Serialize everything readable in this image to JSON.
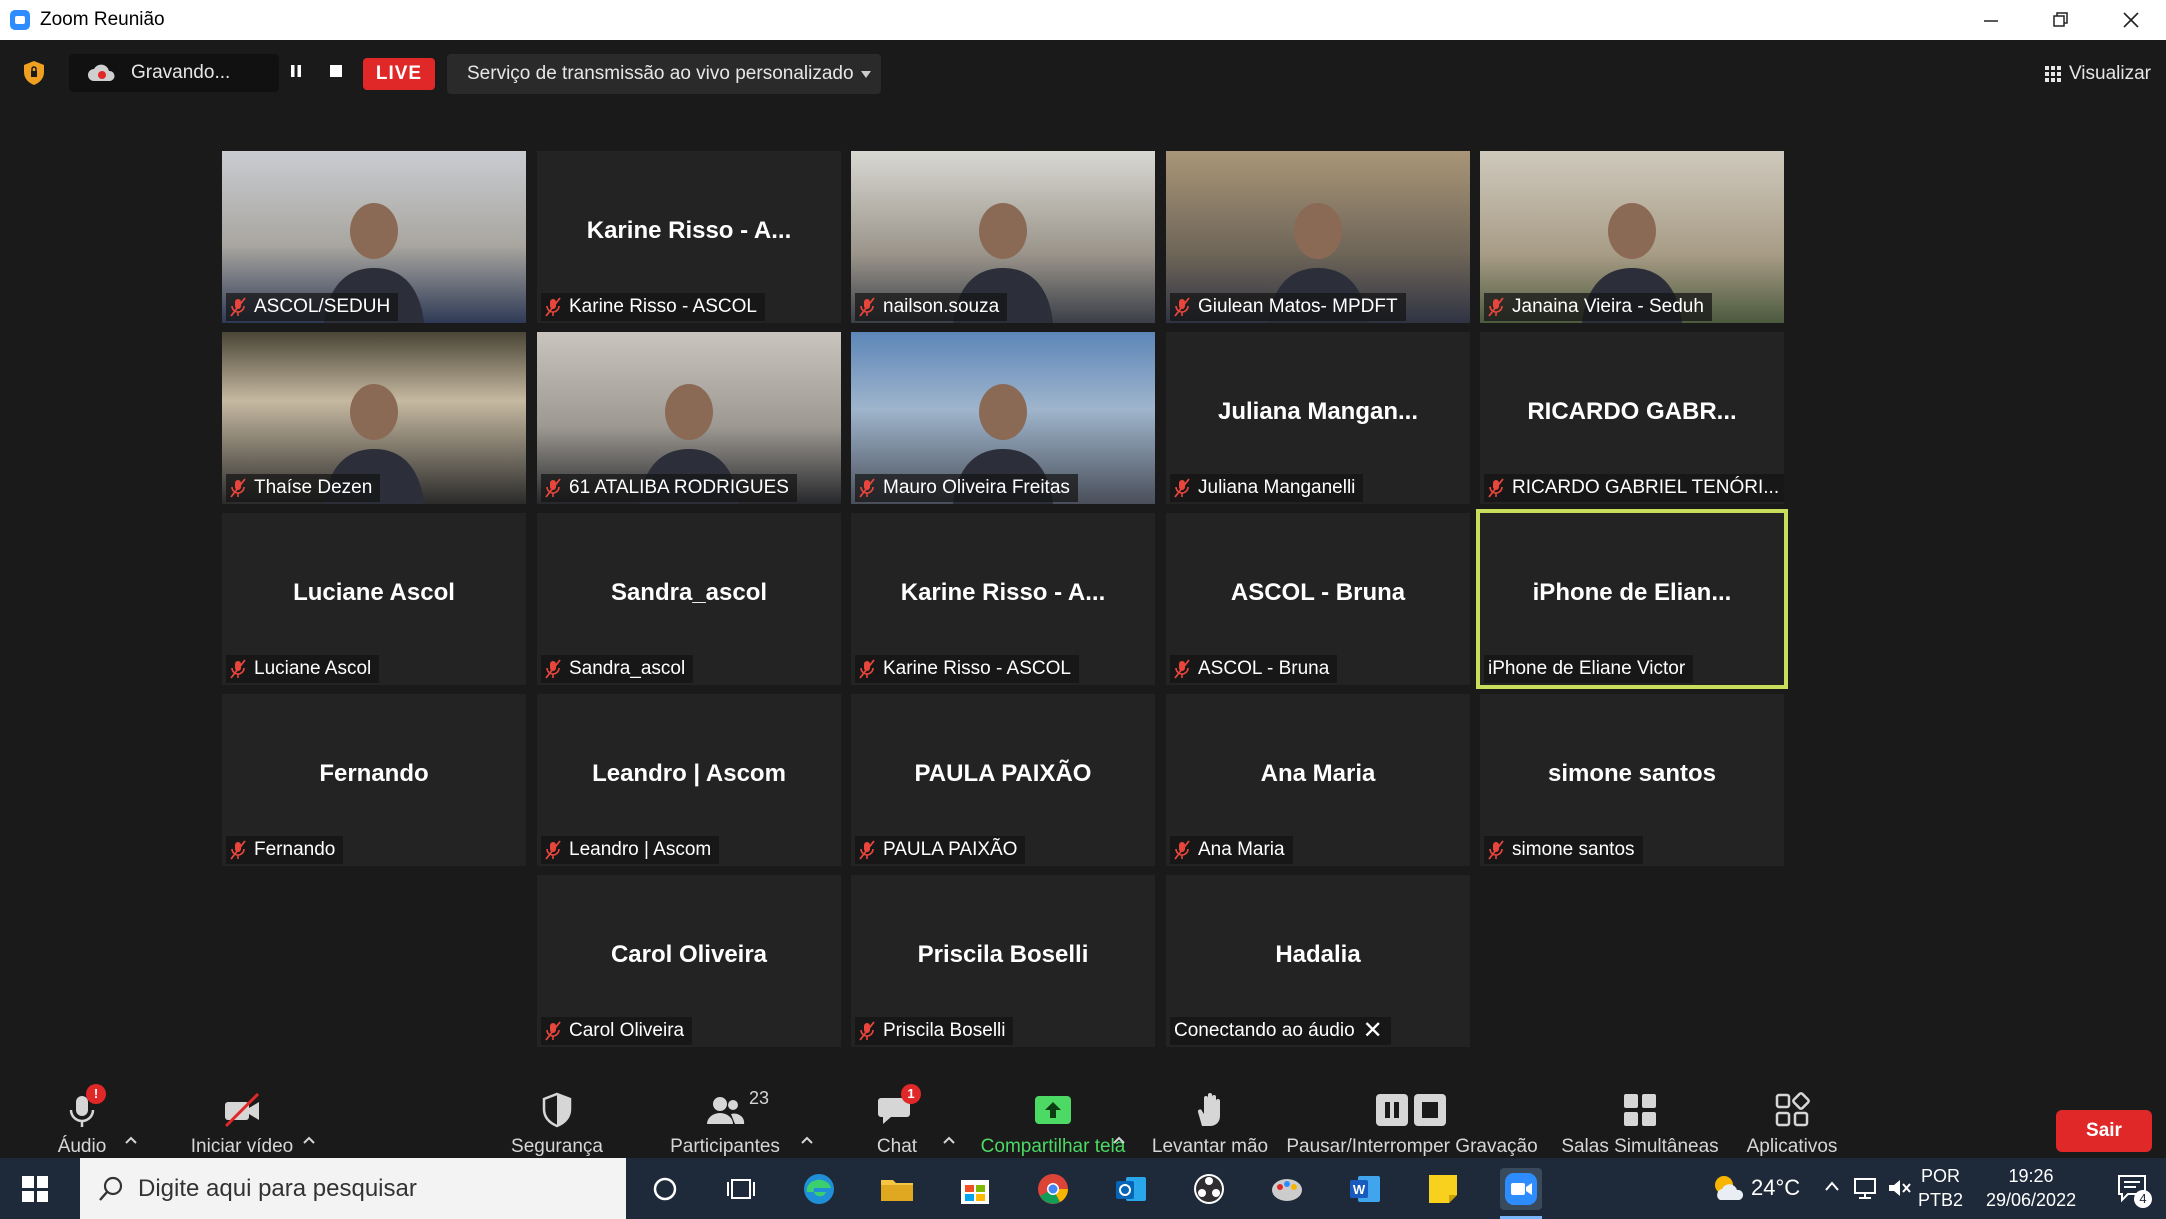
{
  "window": {
    "title": "Zoom Reunião"
  },
  "topbar": {
    "recording_label": "Gravando...",
    "live_label": "LIVE",
    "stream_select": "Serviço de transmissão ao vivo personalizado",
    "view_label": "Visualizar"
  },
  "tiles": [
    {
      "display": "",
      "tag": "ASCOL/SEDUH",
      "video": true
    },
    {
      "display": "Karine Risso - A...",
      "tag": "Karine Risso - ASCOL",
      "video": false
    },
    {
      "display": "",
      "tag": "nailson.souza",
      "video": true
    },
    {
      "display": "",
      "tag": "Giulean Matos- MPDFT",
      "video": true
    },
    {
      "display": "",
      "tag": "Janaina Vieira - Seduh",
      "video": true
    },
    {
      "display": "",
      "tag": "Thaíse Dezen",
      "video": true
    },
    {
      "display": "",
      "tag": "61 ATALIBA RODRIGUES",
      "video": true
    },
    {
      "display": "",
      "tag": "Mauro Oliveira Freitas",
      "video": true
    },
    {
      "display": "Juliana Mangan...",
      "tag": "Juliana Manganelli",
      "video": false
    },
    {
      "display": "RICARDO GABR...",
      "tag": "RICARDO GABRIEL TENÓRI...",
      "video": false
    },
    {
      "display": "Luciane Ascol",
      "tag": "Luciane Ascol",
      "video": false
    },
    {
      "display": "Sandra_ascol",
      "tag": "Sandra_ascol",
      "video": false
    },
    {
      "display": "Karine Risso - A...",
      "tag": "Karine Risso - ASCOL",
      "video": false
    },
    {
      "display": "ASCOL - Bruna",
      "tag": "ASCOL - Bruna",
      "video": false
    },
    {
      "display": "iPhone de Elian...",
      "tag": "iPhone de Eliane Victor",
      "video": false,
      "active": true
    },
    {
      "display": "Fernando",
      "tag": "Fernando",
      "video": false
    },
    {
      "display": "Leandro | Ascom",
      "tag": "Leandro | Ascom",
      "video": false
    },
    {
      "display": "PAULA PAIXÃO",
      "tag": "PAULA PAIXÃO",
      "video": false
    },
    {
      "display": "Ana Maria",
      "tag": "Ana Maria",
      "video": false
    },
    {
      "display": "simone santos",
      "tag": "simone santos",
      "video": false
    },
    {
      "display": "Carol Oliveira",
      "tag": "Carol Oliveira",
      "video": false
    },
    {
      "display": "Priscila Boselli",
      "tag": "Priscila Boselli",
      "video": false
    },
    {
      "display": "Hadalia",
      "tag": "Conectando ao áudio",
      "video": false,
      "connecting": true
    }
  ],
  "toolbar": {
    "audio": "Áudio",
    "audio_badge": "!",
    "video": "Iniciar vídeo",
    "security": "Segurança",
    "participants": "Participantes",
    "participants_count": "23",
    "chat": "Chat",
    "chat_badge": "1",
    "share": "Compartilhar tela",
    "raise_hand": "Levantar mão",
    "pause_recording": "Pausar/Interromper Gravação",
    "breakout": "Salas Simultâneas",
    "apps": "Aplicativos",
    "leave": "Sair"
  },
  "taskbar": {
    "search_placeholder": "Digite aqui para pesquisar",
    "temperature": "24°C",
    "lang1": "POR",
    "lang2": "PTB2",
    "time": "19:26",
    "date": "29/06/2022",
    "notifications": "4"
  },
  "colors": {
    "accent_live": "#e02828",
    "active_speaker": "#c8de5a",
    "share_green": "#4cd964",
    "taskbar": "#1e2a39"
  }
}
